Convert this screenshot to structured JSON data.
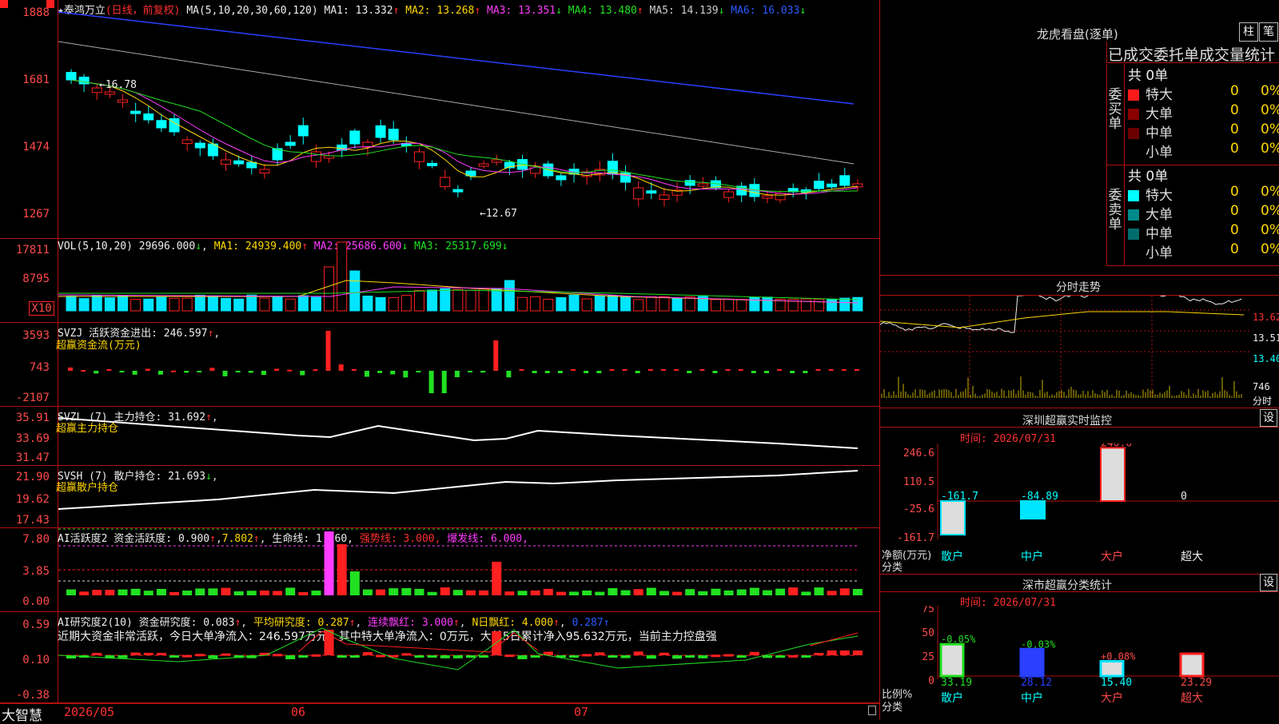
{
  "main": {
    "prefix": "★",
    "stock": "泰鸿万立",
    "mode": "(日线，前复权)",
    "ma_label": "MA(5,10,20,30,60,120)",
    "ma": [
      {
        "k": "MA1:",
        "v": "13.332",
        "a": "↑",
        "c": "#eee"
      },
      {
        "k": "MA2:",
        "v": "13.268",
        "a": "↑",
        "c": "#ffd700"
      },
      {
        "k": "MA3:",
        "v": "13.351",
        "a": "↓",
        "c": "#ff3cff"
      },
      {
        "k": "MA4:",
        "v": "13.480",
        "a": "↑",
        "c": "#22e022"
      },
      {
        "k": "MA5:",
        "v": "14.139",
        "a": "↓",
        "c": "#cccccc"
      },
      {
        "k": "MA6:",
        "v": "16.033",
        "a": "↓",
        "c": "#2a5bff"
      }
    ],
    "y_ticks": [
      "1888",
      "1681",
      "1474",
      "1267"
    ],
    "high_label": "16.78",
    "low_label": "12.67"
  },
  "vol": {
    "title": "VOL(5,10,20)",
    "value": "29696.000",
    "ma": [
      {
        "k": "MA1:",
        "v": "24939.400",
        "a": "↑",
        "c": "#ffd700"
      },
      {
        "k": "MA2:",
        "v": "25686.600",
        "a": "↓",
        "c": "#ff3cff"
      },
      {
        "k": "MA3:",
        "v": "25317.699",
        "a": "↓",
        "c": "#22e022"
      }
    ],
    "y_ticks": [
      "17811",
      "8795"
    ],
    "unit": "X10"
  },
  "svzj": {
    "title": "SVZJ  活跃资金进出:",
    "value": "246.597",
    "arrow": "↑",
    "sub": "超赢资金流(万元)",
    "y_ticks": [
      "3593",
      "743",
      "-2107"
    ]
  },
  "svzl": {
    "title": "SVZL (7) 主力持仓:",
    "value": "31.692",
    "arrow": "↑",
    "sub": "超赢主力持仓",
    "y_ticks": [
      "35.91",
      "33.69",
      "31.47"
    ]
  },
  "svsh": {
    "title": "SVSH (7) 散户持仓:",
    "value": "21.693",
    "arrow": "↓",
    "sub": "超赢散户持仓",
    "y_ticks": [
      "21.90",
      "19.62",
      "17.43"
    ]
  },
  "ai_act": {
    "title": "AI活跃度2 资金活跃度:",
    "v1": "0.900",
    "v2": "7.802",
    "life": "生命线: 1.560,",
    "strong": "强势线: 3.000,",
    "burst": "爆发线: 6.000,",
    "y_ticks": [
      "7.80",
      "3.85",
      "0.00"
    ]
  },
  "ai_res": {
    "title": "AI研究度2(10) 资金研究度: 0.083",
    "avg": "平均研究度: 0.287",
    "cont": "连续飘红: 3.000",
    "nday": "N日飘红: 4.000",
    "last": "0.287",
    "summary": "近期大资金非常活跃，今日大单净流入：246.597万元，其中特大单净流入：0万元，大单5日累计净入95.632万元，当前主力控盘强",
    "y_ticks": [
      "0.59",
      "0.10",
      "-0.38"
    ]
  },
  "xaxis": {
    "brand": "大智慧",
    "dates": [
      "2026/05",
      "06",
      "07"
    ]
  },
  "right": {
    "dragon_title": "龙虎看盘(逐单)",
    "btn_a": "柱",
    "btn_b": "笔",
    "tabs": "已成交委托单成交量统计",
    "buy_total": "共 0单",
    "sell_total": "共 0单",
    "buy_side": "委买单",
    "sell_side": "委卖单",
    "buy_rows": [
      {
        "n": "特大",
        "v": "0",
        "p": "0%",
        "c": "#ff1a1a"
      },
      {
        "n": "大单",
        "v": "0",
        "p": "0%",
        "c": "#8a0000"
      },
      {
        "n": "中单",
        "v": "0",
        "p": "0%",
        "c": "#6a0000"
      },
      {
        "n": "小单",
        "v": "0",
        "p": "0%",
        "c": "#000"
      }
    ],
    "sell_rows": [
      {
        "n": "特大",
        "v": "0",
        "p": "0%",
        "c": "#00ffff"
      },
      {
        "n": "大单",
        "v": "0",
        "p": "0%",
        "c": "#008a8a"
      },
      {
        "n": "中单",
        "v": "0",
        "p": "0%",
        "c": "#006d6d"
      },
      {
        "n": "小单",
        "v": "0",
        "p": "0%",
        "c": "#000"
      }
    ],
    "intraday_title": "分时走势",
    "intraday_ticks": [
      "13.62",
      "13.51",
      "13.40"
    ],
    "intraday_vol": "746",
    "intraday_vol_unit": "分时",
    "monitor_title": "深圳超赢实时监控",
    "set": "设",
    "time_label": "时间: 2026/07/31",
    "net_ticks": [
      "246.6",
      "110.5",
      "-25.6",
      "-161.7"
    ],
    "net_label": "净额(万元)",
    "cat_label": "分类",
    "net_values": [
      {
        "cat": "散户",
        "v": "-161.7"
      },
      {
        "cat": "中户",
        "v": "-84.89"
      },
      {
        "cat": "大户",
        "v": "246.6"
      },
      {
        "cat": "超大",
        "v": "0"
      }
    ],
    "stat_title": "深市超赢分类统计",
    "ratio_ticks": [
      "75",
      "50",
      "25",
      "0"
    ],
    "ratio_label": "比例%",
    "ratio_values": [
      {
        "cat": "散户",
        "v": "33.19",
        "chg": "-0.05%"
      },
      {
        "cat": "中户",
        "v": "28.12",
        "chg": "-0.03%"
      },
      {
        "cat": "大户",
        "v": "15.40",
        "chg": "+0.08%"
      },
      {
        "cat": "超大",
        "v": "23.29",
        "chg": ""
      }
    ]
  },
  "colors": {
    "frame": "#b01010",
    "up": "#ff2020",
    "down": "#00ffff",
    "vol_down": "#00e5ff"
  }
}
